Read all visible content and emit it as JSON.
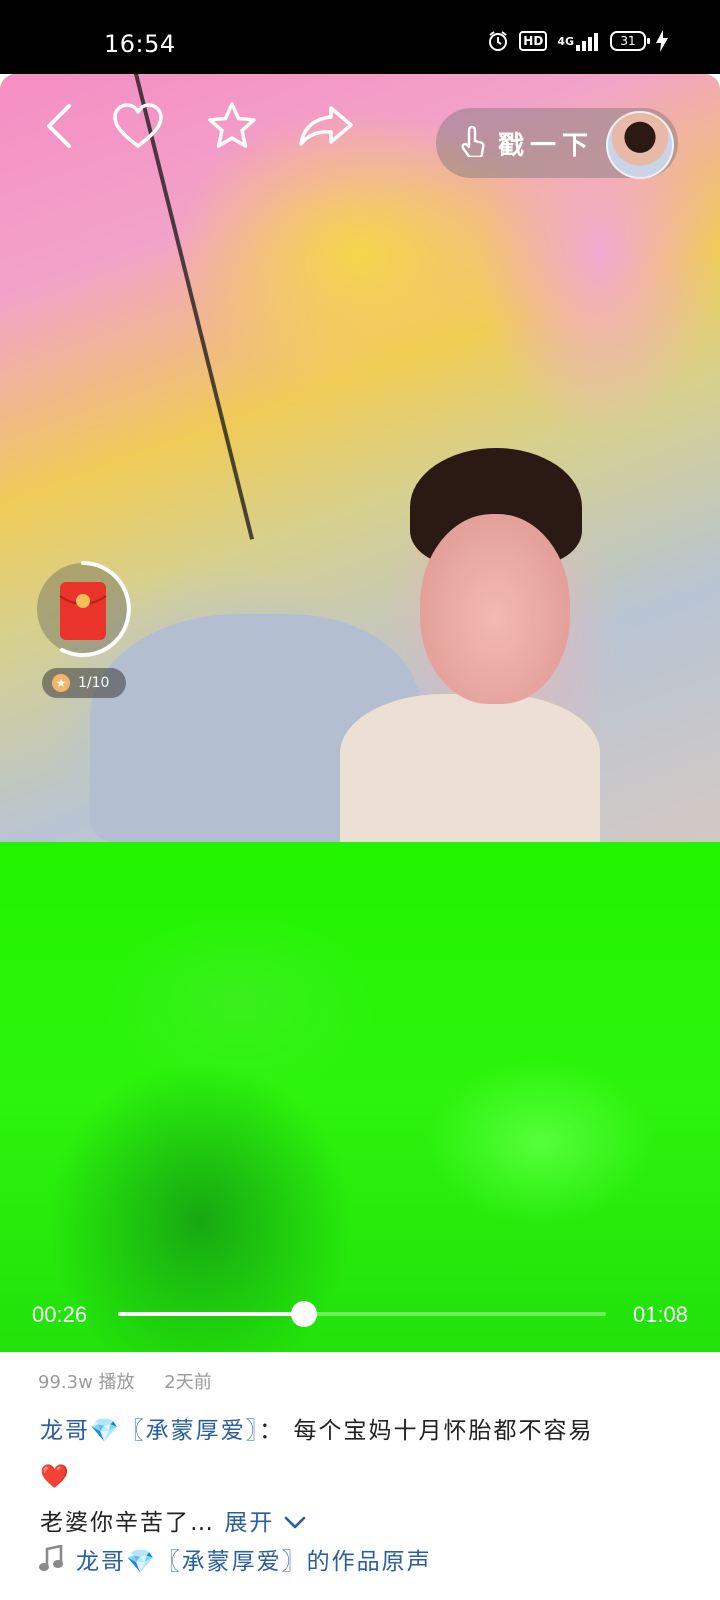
{
  "status_bar": {
    "time": "16:54",
    "network": "4G",
    "hd_label": "HD",
    "battery": "31"
  },
  "video": {
    "poke_label": "戳一下",
    "redpack_progress": "1/10",
    "current_time": "00:26",
    "duration": "01:08",
    "progress_fraction": 0.382
  },
  "info": {
    "plays": "99.3w 播放",
    "posted": "2天前",
    "author": "龙哥💎〖承蒙厚爱〗",
    "separator": "：",
    "caption_line1": "每个宝妈十月怀胎都不容易",
    "caption_heart": "❤️",
    "caption_line2": "老婆你辛苦了…",
    "expand_label": "展开",
    "music_label": "龙哥💎〖承蒙厚爱〗的作品原声"
  },
  "colors": {
    "accent_link": "#2a5f9e",
    "video_bottom": "#29f200"
  },
  "icons": {
    "back": "chevron-left-icon",
    "like": "heart-icon",
    "favorite": "star-icon",
    "share": "share-arrow-icon",
    "poke": "hand-tap-icon",
    "music": "music-note-icon"
  }
}
